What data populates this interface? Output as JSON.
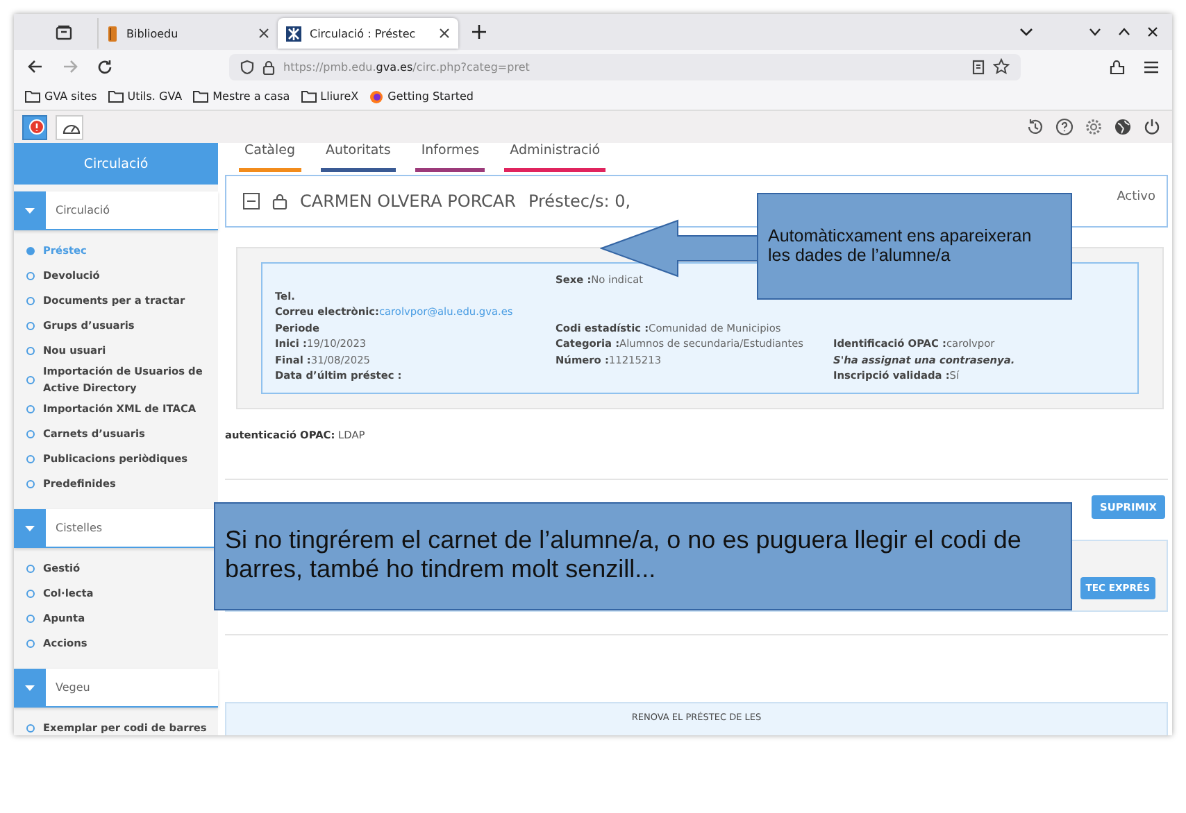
{
  "browser": {
    "tabs": [
      {
        "title": "Biblioedu",
        "selected": false
      },
      {
        "title": "Circulació : Préstec",
        "selected": true
      }
    ],
    "url": "https://pmb.edu.**gva.es**/circ.php?categ=pret",
    "bookmarks": [
      {
        "label": "GVA sites",
        "kind": "folder"
      },
      {
        "label": "Utils. GVA",
        "kind": "folder"
      },
      {
        "label": "Mestre a casa",
        "kind": "folder"
      },
      {
        "label": "LliureX",
        "kind": "folder"
      },
      {
        "label": "Getting Started",
        "kind": "site"
      }
    ]
  },
  "app": {
    "module_title": "Circulació",
    "menu": [
      {
        "label": "Catàleg",
        "color": "#f28c1c"
      },
      {
        "label": "Autoritats",
        "color": "#3a5a94"
      },
      {
        "label": "Informes",
        "color": "#9c3a7a"
      },
      {
        "label": "Administració",
        "color": "#e0245e"
      }
    ],
    "sidebar": [
      {
        "title": "Circulació",
        "items": [
          {
            "label": "Préstec",
            "selected": true
          },
          {
            "label": "Devolució",
            "selected": false
          },
          {
            "label": "Documents per a tractar",
            "selected": false
          },
          {
            "label": "Grups d’usuaris",
            "selected": false
          },
          {
            "label": "Nou usuari",
            "selected": false
          },
          {
            "label": "Importación de Usuarios de Active Directory",
            "selected": false
          },
          {
            "label": "Importación XML de ITACA",
            "selected": false
          },
          {
            "label": "Carnets d’usuaris",
            "selected": false
          },
          {
            "label": "Publicacions periòdiques",
            "selected": false
          },
          {
            "label": "Predefinides",
            "selected": false
          }
        ]
      },
      {
        "title": "Cistelles",
        "items": [
          {
            "label": "Gestió",
            "selected": false
          },
          {
            "label": "Col·lecta",
            "selected": false
          },
          {
            "label": "Apunta",
            "selected": false
          },
          {
            "label": "Accions",
            "selected": false
          }
        ]
      },
      {
        "title": "Vegeu",
        "items": [
          {
            "label": "Exemplar per codi de barres",
            "selected": false
          }
        ]
      }
    ],
    "reader": {
      "name": "CARMEN OLVERA PORCAR",
      "summary": "Préstec/s: 0,",
      "status": "Activo",
      "rows": [
        {
          "middle": {
            "label": "Sexe :",
            "value": "No indicat"
          }
        },
        {
          "left": {
            "label": "Tel."
          }
        },
        {
          "left": {
            "label": "Correu electrònic:",
            "value": "carolvpor@alu.edu.gva.es",
            "kind": "link"
          }
        },
        {
          "left": {
            "label": "Periode"
          },
          "middle": {
            "label": "Codi estadístic :",
            "value": "Comunidad de Municipios"
          }
        },
        {
          "left": {
            "label": "Inici :",
            "value": "19/10/2023"
          },
          "middle": {
            "label": "Categoria :",
            "value": "Alumnos de secundaria/Estudiantes"
          },
          "right": {
            "label": "Identificació OPAC :",
            "value": "carolvpor"
          }
        },
        {
          "left": {
            "label": "Final :",
            "value": "31/08/2025"
          },
          "middle": {
            "label": "Número :",
            "value": "11215213"
          },
          "right": {
            "label": "S'ha assignat una contrasenya.",
            "kind": "note"
          }
        },
        {
          "left": {
            "label": "Data d’últim préstec :"
          },
          "right": {
            "label": "Inscripció validada :",
            "value": "Sí"
          }
        }
      ],
      "auth": {
        "label": "autenticació OPAC:",
        "value": "LDAP"
      }
    },
    "delete_button": "SUPRIMIX",
    "express_button": "TEC EXPRÉS",
    "renew_title": "RENOVA EL PRÉSTEC DE LES"
  },
  "callouts": [
    {
      "text": "Automàticxament ens apareixeran les dades de l’alumne/a",
      "kind": "arrow"
    },
    {
      "text": "Si no tingrérem el carnet de l’alumne/a, o no es puguera llegir el codi de barres, també ho tindrem molt senzill...",
      "kind": "plain"
    }
  ]
}
